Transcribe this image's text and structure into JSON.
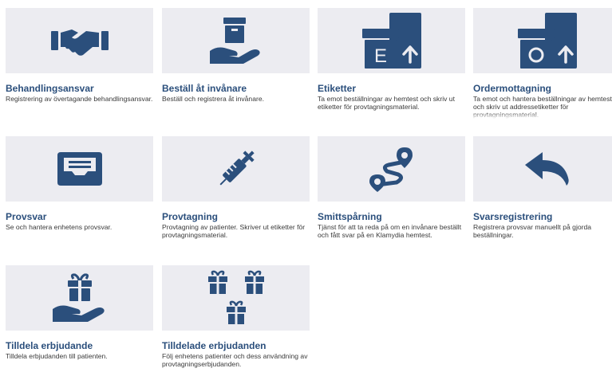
{
  "tiles": [
    {
      "title": "Behandlingsansvar",
      "description": "Registrering av övertagande behandlingsansvar.",
      "icon": "handshake-icon"
    },
    {
      "title": "Beställ åt invånare",
      "description": "Beställ och registrera åt invånare.",
      "icon": "hand-holding-box-icon"
    },
    {
      "title": "Etiketter",
      "description": "Ta emot beställningar av hemtest och skriv ut etiketter för provtagningsmaterial.",
      "icon": "label-upload-icon"
    },
    {
      "title": "Ordermottagning",
      "description": "Ta emot och hantera beställningar av hemtest och skriv ut addressetiketter för provtagningsmaterial.",
      "icon": "order-upload-icon"
    },
    {
      "title": "Provsvar",
      "description": "Se och hantera enhetens provsvar.",
      "icon": "inbox-tray-icon"
    },
    {
      "title": "Provtagning",
      "description": "Provtagning av patienter. Skriver ut etiketter för provtagningsmaterial.",
      "icon": "syringe-icon"
    },
    {
      "title": "Smittspårning",
      "description": "Tjänst för att ta reda på om en invånare beställt och fått svar på en Klamydia hemtest.",
      "icon": "route-icon"
    },
    {
      "title": "Svarsregistrering",
      "description": "Registrera provsvar manuellt på gjorda beställningar.",
      "icon": "reply-arrow-icon"
    },
    {
      "title": "Tilldela erbjudande",
      "description": "Tilldela erbjudanden till patienten.",
      "icon": "hand-holding-gift-icon"
    },
    {
      "title": "Tilldelade erbjudanden",
      "description": "Följ enhetens patienter och dess användning av provtagningserbjudanden.",
      "icon": "gifts-icon"
    }
  ]
}
